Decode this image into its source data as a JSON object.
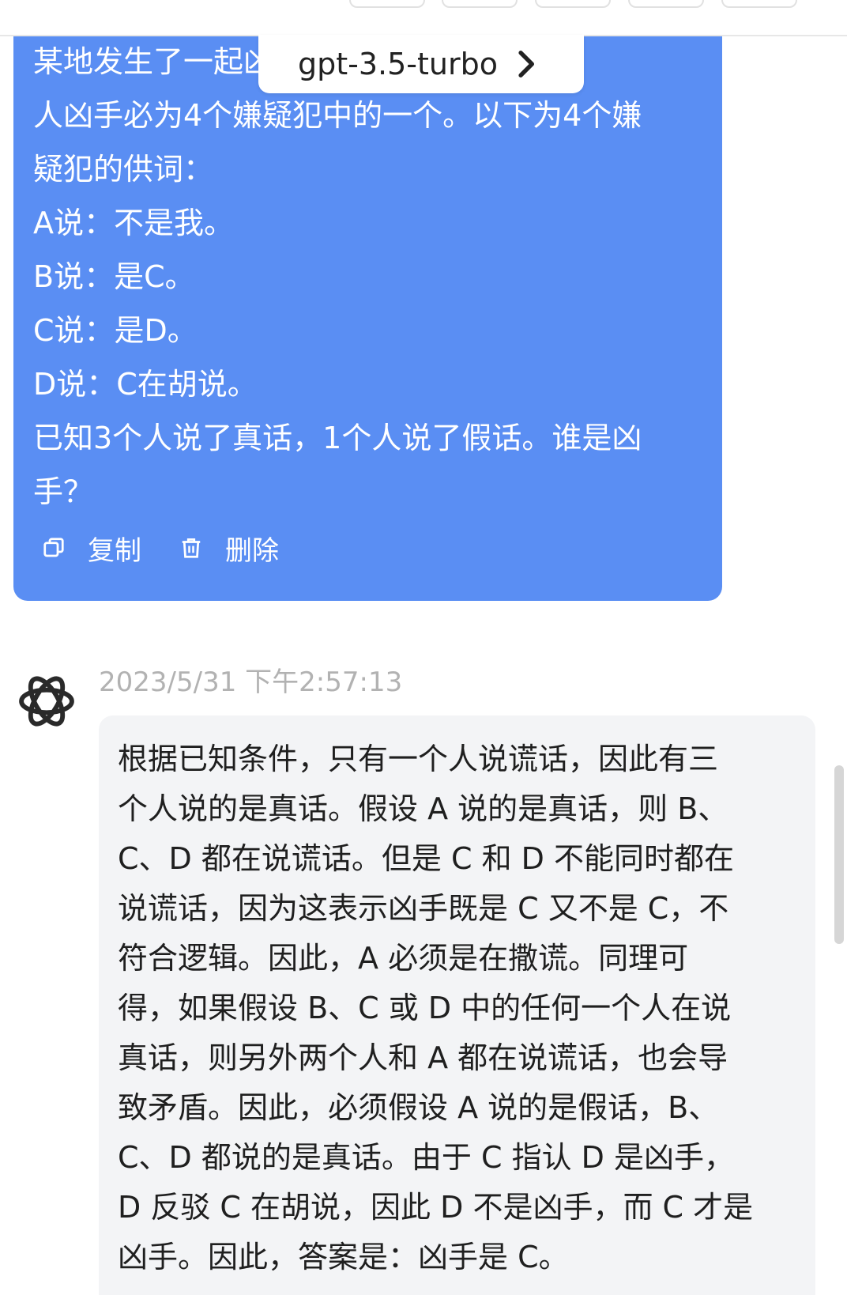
{
  "model_selector": {
    "label": "gpt-3.5-turbo"
  },
  "user_message": {
    "lines": [
      "某地发生了一起凶杀案，经过侦查确定杀",
      "人凶手必为4个嫌疑犯中的一个。以下为4个嫌",
      "疑犯的供词：",
      "A说：不是我。",
      "B说：是C。",
      "C说：是D。",
      "D说：C在胡说。",
      "已知3个人说了真话，1个人说了假话。谁是凶",
      "手？"
    ],
    "actions": {
      "copy": "复制",
      "delete": "删除"
    }
  },
  "assistant_message": {
    "timestamp": "2023/5/31 下午2:57:13",
    "lines": [
      "根据已知条件，只有一个人说谎话，因此有三",
      "个人说的是真话。假设 A 说的是真话，则 B、",
      "C、D 都在说谎话。但是 C 和 D 不能同时都在",
      "说谎话，因为这表示凶手既是 C 又不是 C，不",
      "符合逻辑。因此，A 必须是在撒谎。同理可",
      "得，如果假设 B、C 或 D 中的任何一个人在说",
      "真话，则另外两个人和 A 都在说谎话，也会导",
      "致矛盾。因此，必须假设 A 说的是假话，B、",
      "C、D 都说的是真话。由于 C 指认 D 是凶手，",
      "D 反驳 C 在胡说，因此 D 不是凶手，而 C 才是",
      "凶手。因此，答案是：凶手是 C。"
    ]
  },
  "icons": {
    "copy": "copy-icon",
    "delete": "trash-icon",
    "chevron": "chevron-right-icon",
    "avatar": "openai-logo-icon"
  },
  "colors": {
    "user_bubble": "#5a8ef3",
    "assistant_bubble": "#f3f4f6",
    "timestamp": "#b2b2b2"
  }
}
